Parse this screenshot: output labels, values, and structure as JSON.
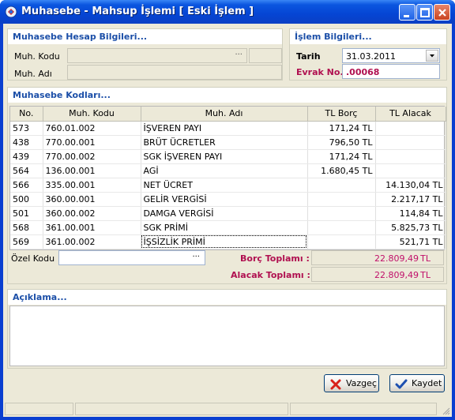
{
  "window": {
    "title": "Muhasebe - Mahsup İşlemi [ Eski İşlem ]"
  },
  "hesap": {
    "title": "Muhasebe Hesap Bilgileri...",
    "kod_label": "Muh. Kodu",
    "ad_label": "Muh. Adı",
    "kod_value": "",
    "ad_value": "",
    "ellipsis": "···"
  },
  "islem": {
    "title": "İşlem Bilgileri...",
    "tarih_label": "Tarih",
    "tarih_value": "31.03.2011",
    "evrak_label": "Evrak No.",
    "evrak_value": ".00068"
  },
  "kodlar": {
    "title": "Muhasebe Kodları...",
    "columns": [
      "No.",
      "Muh. Kodu",
      "Muh. Adı",
      "TL Borç",
      "TL Alacak"
    ],
    "rows": [
      [
        "573",
        "760.01.002",
        "İŞVEREN PAYI",
        "171,24 TL",
        ""
      ],
      [
        "438",
        "770.00.001",
        "BRÜT ÜCRETLER",
        "796,50 TL",
        ""
      ],
      [
        "439",
        "770.00.002",
        "SGK İŞVEREN PAYI",
        "171,24 TL",
        ""
      ],
      [
        "564",
        "136.00.001",
        "AGİ",
        "1.680,45 TL",
        ""
      ],
      [
        "566",
        "335.00.001",
        "NET ÜCRET",
        "",
        "14.130,04 TL"
      ],
      [
        "500",
        "360.00.001",
        "GELİR VERGİSİ",
        "",
        "2.217,17 TL"
      ],
      [
        "501",
        "360.00.002",
        "DAMGA VERGİSİ",
        "",
        "114,84 TL"
      ],
      [
        "568",
        "361.00.001",
        "SGK PRİMİ",
        "",
        "5.825,73 TL"
      ],
      [
        "569",
        "361.00.002",
        "İŞSİZLİK PRİMİ",
        "",
        "521,71 TL"
      ]
    ],
    "ozel_kodu_label": "Özel Kodu",
    "ozel_kodu_value": "",
    "ellipsis": "···",
    "borc_label": "Borç Toplamı :",
    "borc_value": "22.809,49",
    "alacak_label": "Alacak Toplamı :",
    "alacak_value": "22.809,49",
    "currency": "TL"
  },
  "aciklama": {
    "title": "Açıklama...",
    "value": ""
  },
  "buttons": {
    "vazgec": "Vazgeç",
    "kaydet": "Kaydet"
  },
  "colors": {
    "accent": "#1c4fa8",
    "red_label": "#b01050",
    "total_text": "#c0106a"
  }
}
